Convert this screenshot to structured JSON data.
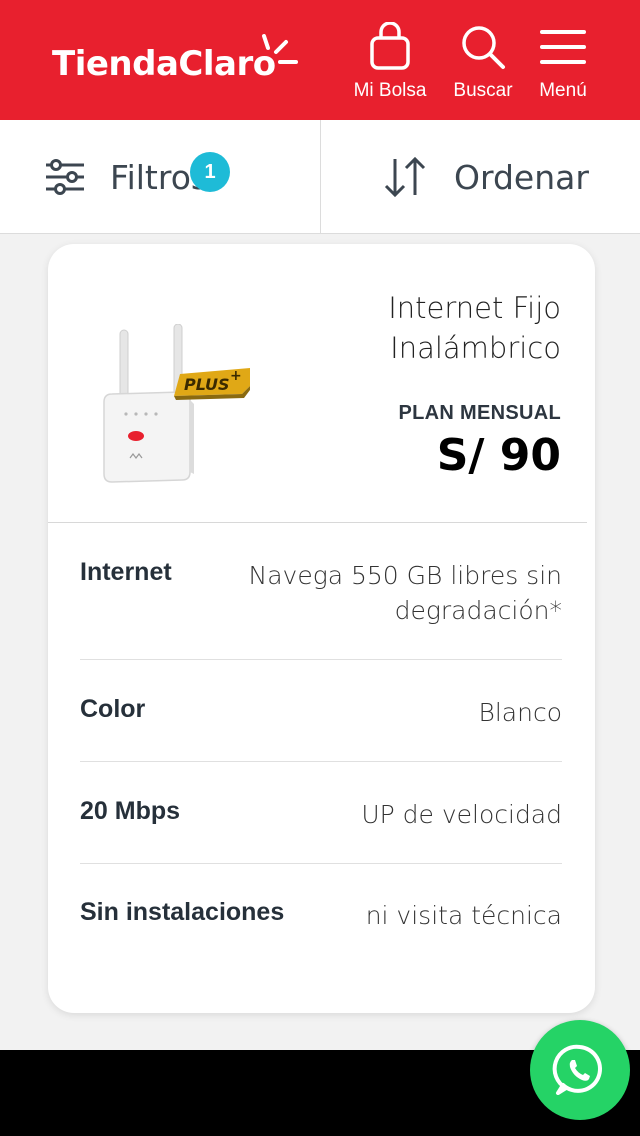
{
  "header": {
    "brand_part1": "Tienda",
    "brand_part2": "Claro",
    "bag_label": "Mi Bolsa",
    "search_label": "Buscar",
    "menu_label": "Menú",
    "brand_color": "#e8202e"
  },
  "filterbar": {
    "filters_label": "Filtros",
    "filters_count": "1",
    "sort_label": "Ordenar",
    "badge_color": "#1ebbd7"
  },
  "product": {
    "title_line1": "Internet Fijo",
    "title_line2": "Inalámbrico",
    "badge_text": "PLUS+",
    "plan_label": "PLAN MENSUAL",
    "price": "S/ 90",
    "specs": [
      {
        "key": "Internet",
        "value_line1": "Navega 550 GB libres sin",
        "value_line2": "degradación*"
      },
      {
        "key": "Color",
        "value_line1": "Blanco",
        "value_line2": ""
      },
      {
        "key": "20 Mbps",
        "value_line1": "UP de velocidad",
        "value_line2": ""
      },
      {
        "key": "Sin instalaciones",
        "value_line1": "ni visita técnica",
        "value_line2": ""
      }
    ]
  },
  "whatsapp": {
    "icon": "whatsapp-icon",
    "color": "#25d366"
  }
}
